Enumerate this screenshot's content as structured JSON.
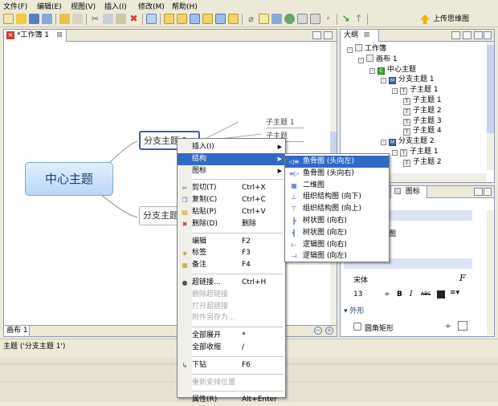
{
  "menubar": [
    {
      "label": "文件(F)"
    },
    {
      "label": "编辑(E)"
    },
    {
      "label": "视图(V)"
    },
    {
      "label": "插入(I)"
    },
    {
      "label": "修改(M)"
    },
    {
      "label": "帮助(H)"
    }
  ],
  "toolbar": {
    "upload_label": "上传思维图",
    "icons": [
      "new-icon",
      "open-icon",
      "save-icon",
      "save-as-icon",
      "undo-icon",
      "redo-icon",
      "cut-icon",
      "copy-icon",
      "paste-icon",
      "delete-icon",
      "insert-topic-icon",
      "subtopic-icon",
      "parent-topic-icon",
      "floating-topic-icon",
      "relationship-icon",
      "boundary-icon",
      "summary-icon",
      "attachment-icon",
      "note-icon",
      "hyperlink-icon",
      "image-icon",
      "marker-icon",
      "label-icon",
      "drill-down-icon",
      "drill-up-icon"
    ]
  },
  "editor": {
    "tab_label": "*工作簿 1",
    "sheet_tab": "画布 1",
    "central_topic": "中心主题",
    "branch_1": "分支主题 1",
    "branch_2": "分支主题",
    "subtopics": [
      "子主题 1",
      "子主题"
    ]
  },
  "outline": {
    "tab_label": "大纲",
    "rows": [
      {
        "label": "工作簿",
        "icon": "workbook-icon",
        "badge": ""
      },
      {
        "label": "画布 1",
        "icon": "sheet-icon",
        "badge": ""
      },
      {
        "label": "中心主题",
        "icon": "central-topic-icon",
        "badge": "C"
      },
      {
        "label": "分支主题 1",
        "icon": "main-topic-icon",
        "badge": "M"
      },
      {
        "label": "子主题 1",
        "icon": "topic-icon",
        "badge": "T"
      },
      {
        "label": "子主题 1",
        "icon": "topic-icon",
        "badge": "T"
      },
      {
        "label": "子主题 2",
        "icon": "topic-icon",
        "badge": "T"
      },
      {
        "label": "子主题 3",
        "icon": "topic-icon",
        "badge": "T"
      },
      {
        "label": "子主题 4",
        "icon": "topic-icon",
        "badge": "T"
      },
      {
        "label": "分支主题 2",
        "icon": "main-topic-icon",
        "badge": "M"
      },
      {
        "label": "子主题 1",
        "icon": "topic-icon",
        "badge": "T"
      },
      {
        "label": "子主题 2",
        "icon": "topic-icon",
        "badge": "T"
      }
    ]
  },
  "props": {
    "tab_label": "图标",
    "partial_text": "图",
    "font_name": "宋体",
    "font_size": "13",
    "section_shape": "外形",
    "shape_value": "圆角矩形",
    "bold": "B",
    "italic": "I",
    "strike": "ABC",
    "font_btn": "F"
  },
  "status_text": "主题 ('分支主题 1')",
  "context_menu": {
    "items": [
      {
        "label": "插入(I)",
        "shortcut": "",
        "submenu": true,
        "disabled": false,
        "highlight": false,
        "icon": ""
      },
      {
        "label": "结构",
        "shortcut": "",
        "submenu": true,
        "disabled": false,
        "highlight": true,
        "icon": ""
      },
      {
        "label": "图标",
        "shortcut": "",
        "submenu": true,
        "disabled": false,
        "highlight": false,
        "icon": ""
      },
      {
        "sep": true
      },
      {
        "label": "剪切(T)",
        "shortcut": "Ctrl+X",
        "icon": "cut-icon",
        "glyph": "✂"
      },
      {
        "label": "复制(C)",
        "shortcut": "Ctrl+C",
        "icon": "copy-icon",
        "glyph": "❐"
      },
      {
        "label": "粘贴(P)",
        "shortcut": "Ctrl+V",
        "icon": "paste-icon",
        "glyph": "▤"
      },
      {
        "label": "删除(D)",
        "shortcut": "删除",
        "icon": "delete-icon",
        "glyph": "✖"
      },
      {
        "sep": true
      },
      {
        "label": "编辑",
        "shortcut": "F2"
      },
      {
        "label": "标签",
        "shortcut": "F3",
        "icon": "label-icon",
        "glyph": "◈"
      },
      {
        "label": "备注",
        "shortcut": "F4",
        "icon": "note-icon",
        "glyph": "▦"
      },
      {
        "sep": true
      },
      {
        "label": "超链接...",
        "shortcut": "Ctrl+H",
        "icon": "hyperlink-icon",
        "glyph": "●"
      },
      {
        "label": "删除超链接",
        "disabled": true
      },
      {
        "label": "打开超链接",
        "disabled": true
      },
      {
        "label": "附件另存为...",
        "disabled": true
      },
      {
        "sep": true
      },
      {
        "label": "全部展开",
        "shortcut": "*"
      },
      {
        "label": "全部收缩",
        "shortcut": "/"
      },
      {
        "sep": true
      },
      {
        "label": "下钻",
        "shortcut": "F6",
        "icon": "drill-down-icon",
        "glyph": "↳"
      },
      {
        "sep": true
      },
      {
        "label": "重新安排位置",
        "disabled": true
      },
      {
        "sep": true
      },
      {
        "label": "属性(R)",
        "shortcut": "Alt+Enter"
      }
    ]
  },
  "submenu": {
    "items": [
      {
        "label": "鱼骨图 (头向左)",
        "highlight": true,
        "icon": "fishbone-left-icon",
        "glyph": "◁≡"
      },
      {
        "label": "鱼骨图 (头向右)",
        "icon": "fishbone-right-icon",
        "glyph": "≡▷"
      },
      {
        "label": "二维图",
        "icon": "matrix-icon",
        "glyph": "▦"
      },
      {
        "label": "组织结构图 (向下)",
        "icon": "org-chart-down-icon",
        "glyph": "⊥"
      },
      {
        "label": "组织结构图 (向上)",
        "icon": "org-chart-up-icon",
        "glyph": "⊤"
      },
      {
        "label": "树状图 (向右)",
        "icon": "tree-right-icon",
        "glyph": "┣"
      },
      {
        "label": "树状图 (向左)",
        "icon": "tree-left-icon",
        "glyph": "┫"
      },
      {
        "label": "逻辑图 (向右)",
        "icon": "logic-right-icon",
        "glyph": "⊢"
      },
      {
        "label": "逻辑图 (向左)",
        "icon": "logic-left-icon",
        "glyph": "⊣"
      }
    ]
  },
  "colors": {
    "highlight": "#316ac5",
    "central_fill": "#cfe2fb",
    "selected_border": "#3c5fa9"
  }
}
